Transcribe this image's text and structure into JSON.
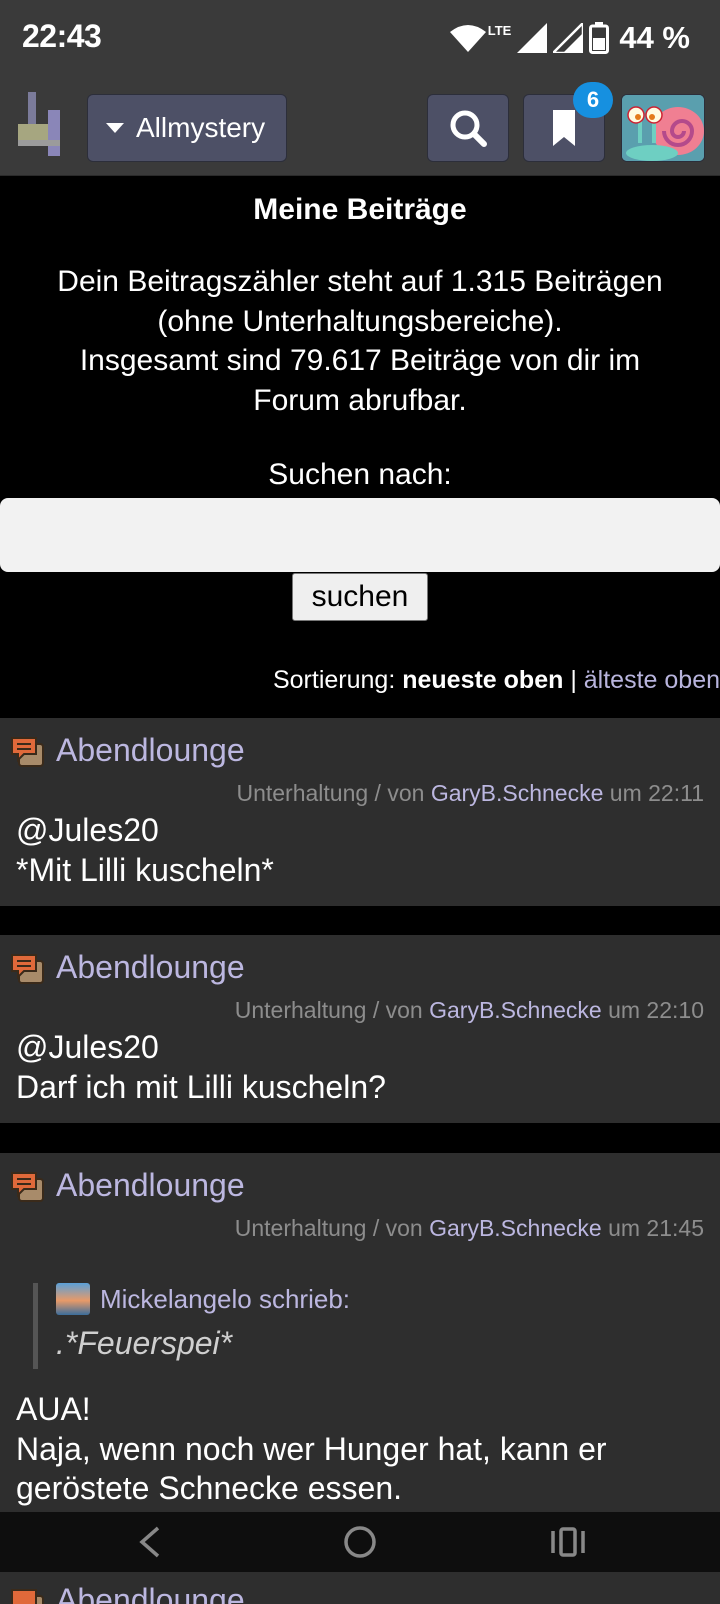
{
  "status_bar": {
    "time": "22:43",
    "network": "LTE",
    "battery": "44 %"
  },
  "header": {
    "forum_selector": "Allmystery",
    "notification_count": "6",
    "icons": [
      "logo-icon",
      "search-icon",
      "bookmark-icon",
      "avatar"
    ]
  },
  "page": {
    "title": "Meine Beiträge",
    "intro_line1": "Dein Beitragszähler steht auf 1.315 Beiträgen",
    "intro_line2": "(ohne Unterhaltungsbereiche).",
    "intro_line3": "Insgesamt sind 79.617 Beiträge von dir im",
    "intro_line4": "Forum abrufbar.",
    "search_label": "Suchen nach:",
    "search_value": "",
    "search_button": "suchen",
    "sort_label": "Sortierung:",
    "sort_active": "neueste oben",
    "sort_separator": "|",
    "sort_other": "älteste oben"
  },
  "posts": [
    {
      "thread": "Abendlounge",
      "category": "Unterhaltung / von",
      "author": "GaryB.Schnecke",
      "time": "um 22:11",
      "line1": "@Jules20",
      "line2": "*Mit Lilli kuscheln*"
    },
    {
      "thread": "Abendlounge",
      "category": "Unterhaltung / von",
      "author": "GaryB.Schnecke",
      "time": "um 22:10",
      "line1": "@Jules20",
      "line2": "Darf ich mit Lilli kuscheln?"
    },
    {
      "thread": "Abendlounge",
      "category": "Unterhaltung / von",
      "author": "GaryB.Schnecke",
      "time": "um 21:45",
      "quote_author": "Mickelangelo schrieb:",
      "quote_text": ".*Feuerspei*",
      "line1": "AUA!",
      "line2": "Naja, wenn noch wer Hunger hat, kann er",
      "line3": "geröstete Schnecke essen."
    },
    {
      "thread": "Abendlounge"
    }
  ],
  "colors": {
    "accent_link": "#bcb7e0",
    "header_bg": "#3a3a3a",
    "button_bg": "#4d5066",
    "badge": "#1690e0",
    "post_bg": "#2e2e2e",
    "post_icon": "#e0693a"
  }
}
